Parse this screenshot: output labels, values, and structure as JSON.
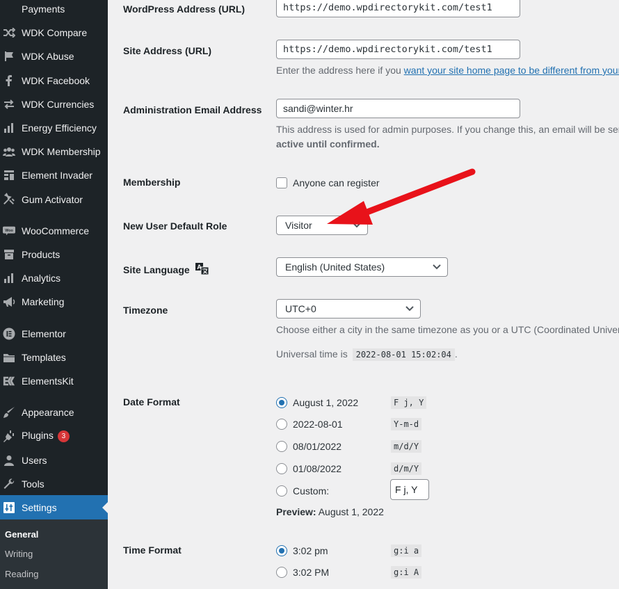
{
  "sidebar": {
    "items": [
      {
        "label": "Payments",
        "icon": "payments-icon"
      },
      {
        "label": "WDK Compare",
        "icon": "shuffle-icon"
      },
      {
        "label": "WDK Abuse",
        "icon": "flag-icon"
      },
      {
        "label": "WDK Facebook",
        "icon": "facebook-icon"
      },
      {
        "label": "WDK Currencies",
        "icon": "currency-exchange-icon"
      },
      {
        "label": "Energy Efficiency",
        "icon": "bar-chart-icon"
      },
      {
        "label": "WDK Membership",
        "icon": "users-group-icon"
      },
      {
        "label": "Element Invader",
        "icon": "layout-icon"
      },
      {
        "label": "Gum Activator",
        "icon": "tools-icon"
      },
      {
        "label": "WooCommerce",
        "icon": "woocommerce-icon"
      },
      {
        "label": "Products",
        "icon": "archive-icon"
      },
      {
        "label": "Analytics",
        "icon": "analytics-icon"
      },
      {
        "label": "Marketing",
        "icon": "megaphone-icon"
      },
      {
        "label": "Elementor",
        "icon": "elementor-icon"
      },
      {
        "label": "Templates",
        "icon": "folder-icon"
      },
      {
        "label": "ElementsKit",
        "icon": "elementskit-icon"
      },
      {
        "label": "Appearance",
        "icon": "paintbrush-icon"
      },
      {
        "label": "Plugins",
        "icon": "plugin-icon",
        "badge": "3"
      },
      {
        "label": "Users",
        "icon": "user-icon"
      },
      {
        "label": "Tools",
        "icon": "wrench-icon"
      },
      {
        "label": "Settings",
        "icon": "settings-sliders-icon"
      }
    ],
    "submenu": [
      {
        "label": "General"
      },
      {
        "label": "Writing"
      },
      {
        "label": "Reading"
      }
    ]
  },
  "form": {
    "wp_address": {
      "label": "WordPress Address (URL)",
      "value": "https://demo.wpdirectorykit.com/test1"
    },
    "site_address": {
      "label": "Site Address (URL)",
      "value": "https://demo.wpdirectorykit.com/test1",
      "desc_prefix": "Enter the address here if you ",
      "desc_link": "want your site home page to be different from your"
    },
    "admin_email": {
      "label": "Administration Email Address",
      "value": "sandi@winter.hr",
      "desc_line1": "This address is used for admin purposes. If you change this, an email will be sent",
      "desc_line2": "active until confirmed."
    },
    "membership": {
      "label": "Membership",
      "checkbox_label": "Anyone can register"
    },
    "default_role": {
      "label": "New User Default Role",
      "value": "Visitor"
    },
    "site_language": {
      "label": "Site Language",
      "value": "English (United States)"
    },
    "timezone": {
      "label": "Timezone",
      "value": "UTC+0",
      "desc": "Choose either a city in the same timezone as you or a UTC (Coordinated Universa",
      "universal_prefix": "Universal time is",
      "universal_time": "2022-08-01 15:02:04",
      "universal_suffix": "."
    },
    "date_format": {
      "label": "Date Format",
      "options": [
        {
          "label": "August 1, 2022",
          "code": "F j, Y"
        },
        {
          "label": "2022-08-01",
          "code": "Y-m-d"
        },
        {
          "label": "08/01/2022",
          "code": "m/d/Y"
        },
        {
          "label": "01/08/2022",
          "code": "d/m/Y"
        }
      ],
      "custom_label": "Custom:",
      "custom_value": "F j, Y",
      "preview_label": "Preview:",
      "preview_value": "August 1, 2022"
    },
    "time_format": {
      "label": "Time Format",
      "options": [
        {
          "label": "3:02 pm",
          "code": "g:i a"
        },
        {
          "label": "3:02 PM",
          "code": "g:i A"
        }
      ]
    }
  },
  "colors": {
    "sidebar_bg": "#1d2327",
    "accent": "#2271b1",
    "badge": "#d63638",
    "annotation_arrow": "#e8121a"
  }
}
